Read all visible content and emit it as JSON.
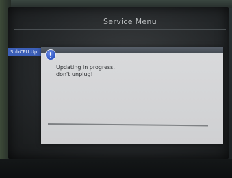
{
  "menu": {
    "title": "Service Menu",
    "selected_item": "SubCPU Up"
  },
  "dialog": {
    "icon": "info-icon",
    "message_line1": "Updating in progress,",
    "message_line2": "don't unplug!",
    "progress_fraction": 0
  },
  "colors": {
    "selection": "#3c5fb8",
    "dialog_background": "#d7d8da",
    "dialog_header": "#4e555d",
    "icon": "#2f56c4"
  }
}
